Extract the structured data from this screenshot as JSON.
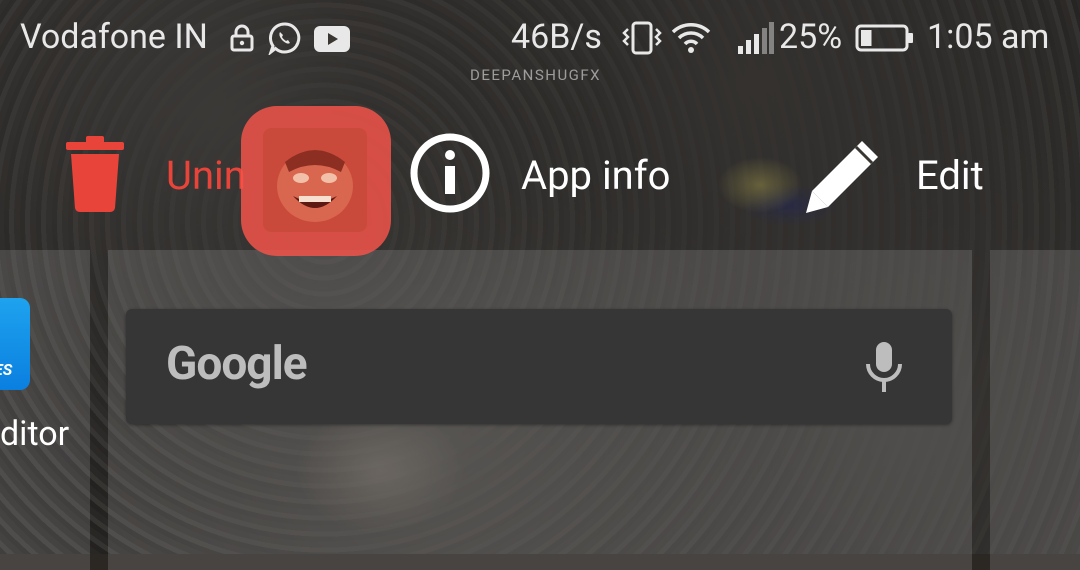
{
  "status_bar": {
    "carrier": "Vodafone IN",
    "watermark": "DEEPANSHUGFX",
    "network_speed": "46B/s",
    "battery_percent": "25%",
    "battery_level": 0.25,
    "time": "1:05 am"
  },
  "drop_targets": {
    "uninstall_label": "Unin",
    "app_info_label": "App info",
    "edit_label": "Edit"
  },
  "home": {
    "left_app_label": "ditor",
    "left_app_badge": "ES"
  },
  "search_bar": {
    "logo_text": "Google"
  }
}
